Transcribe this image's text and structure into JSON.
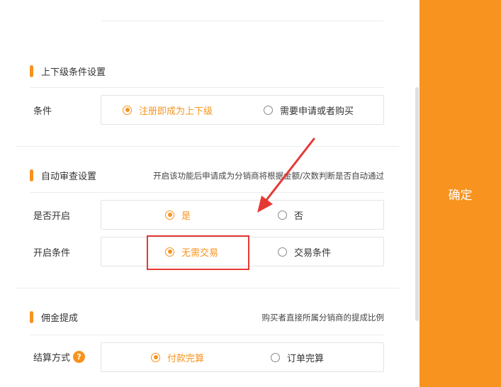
{
  "sections": {
    "hierarchy": {
      "title": "上下级条件设置",
      "row": {
        "label": "条件",
        "options": [
          "注册即成为上下级",
          "需要申请或者购买"
        ],
        "selected": 0
      }
    },
    "auto_review": {
      "title": "自动审查设置",
      "hint": "开启该功能后申请成为分销商将根据金额/次数判断是否自动通过",
      "rows": [
        {
          "label": "是否开启",
          "options": [
            "是",
            "否"
          ],
          "selected": 0
        },
        {
          "label": "开启条件",
          "options": [
            "无需交易",
            "交易条件"
          ],
          "selected": 0
        }
      ]
    },
    "commission": {
      "title": "佣金提成",
      "hint": "购买者直接所属分销商的提成比例",
      "row": {
        "label": "结算方式",
        "help_icon": "?",
        "options": [
          "付款完算",
          "订单完算"
        ],
        "selected": 0
      }
    }
  },
  "confirm_label": "确定",
  "colors": {
    "accent": "#f7931e",
    "highlight": "#e53935"
  },
  "icons": [
    "radio-icon",
    "help-icon",
    "annotation-arrow-icon"
  ]
}
